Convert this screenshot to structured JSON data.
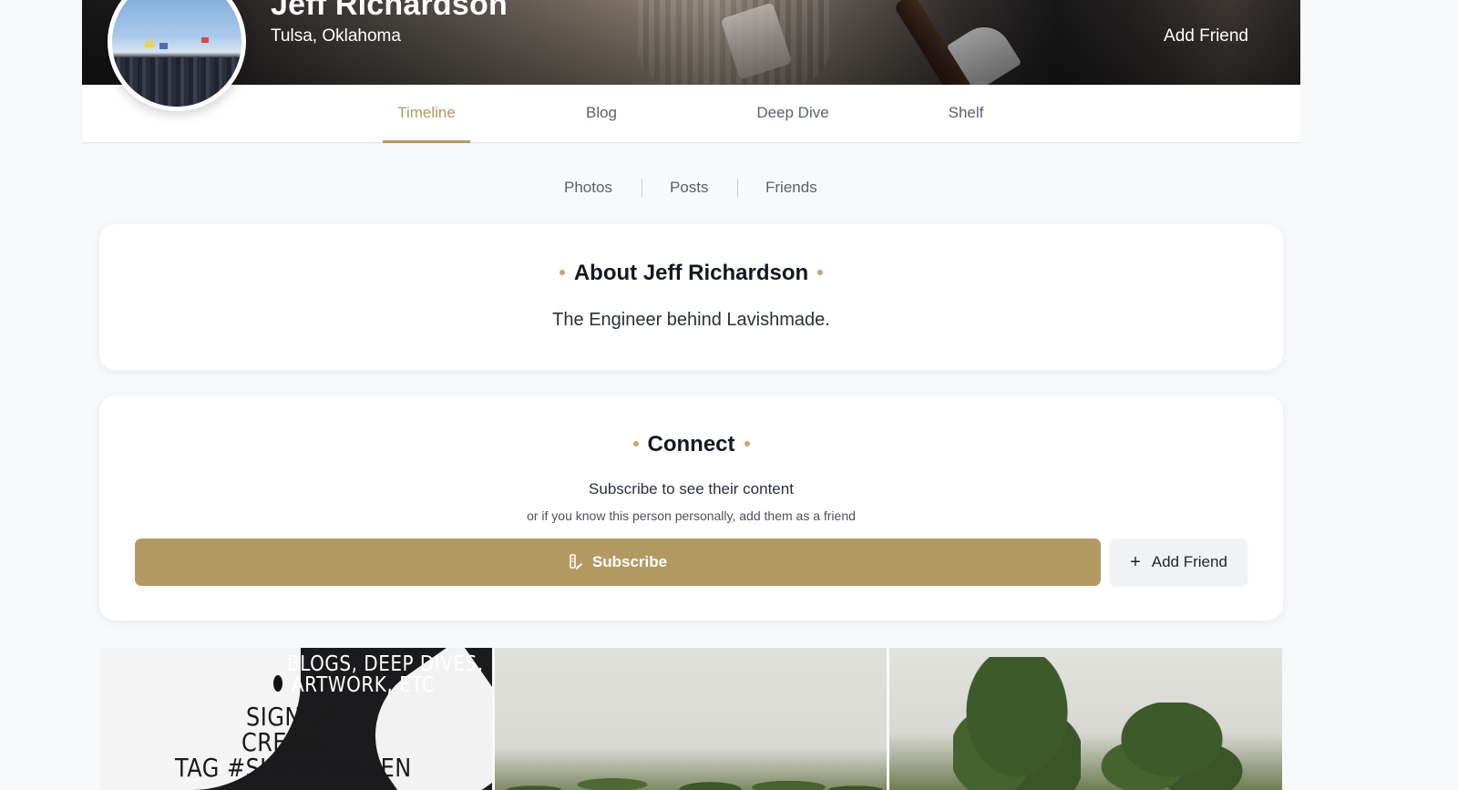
{
  "profile": {
    "name": "Jeff Richardson",
    "location": "Tulsa, Oklahoma",
    "header_action": "Add Friend"
  },
  "tabs": [
    {
      "label": "Timeline",
      "active": true
    },
    {
      "label": "Blog",
      "active": false
    },
    {
      "label": "Deep Dive",
      "active": false
    },
    {
      "label": "Shelf",
      "active": false
    }
  ],
  "subnav": [
    {
      "label": "Photos"
    },
    {
      "label": "Posts"
    },
    {
      "label": "Friends"
    }
  ],
  "about": {
    "title": "About Jeff Richardson",
    "text": "The Engineer behind Lavishmade."
  },
  "connect": {
    "title": "Connect",
    "subtitle": "Subscribe to see their content",
    "hint": "or if you know this person personally, add them as a friend",
    "subscribe_label": "Subscribe",
    "add_friend_label": "Add Friend"
  },
  "photos": [
    {
      "lines": [
        "BLOGS, DEEP DIVES,",
        "ARTWORK, ETC",
        "SIGN UP",
        "CREATE",
        "TAG #SUMMERWEEN"
      ]
    },
    {},
    {}
  ],
  "colors": {
    "accent": "#b39a62",
    "accent_dot": "#c8a56a",
    "page_bg": "#f7f8fa"
  },
  "icons": {
    "subscribe": "subscribe-icon",
    "add_friend": "plus-icon"
  }
}
